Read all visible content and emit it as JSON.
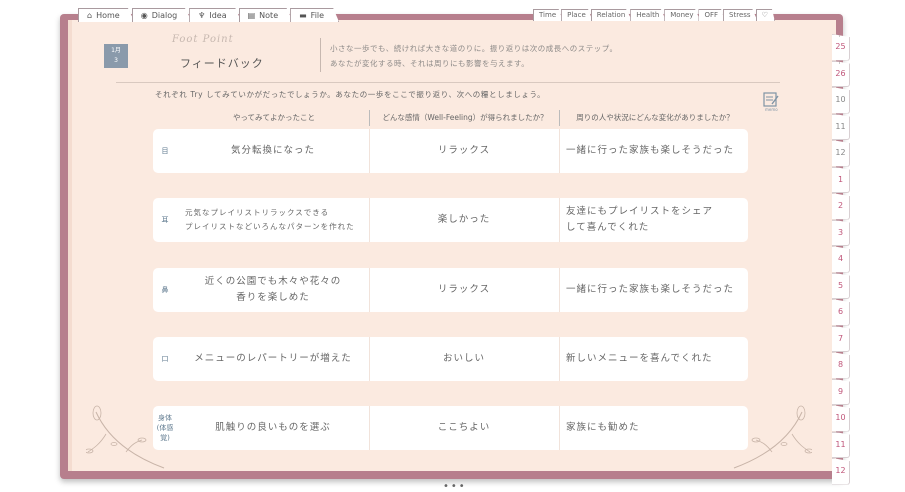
{
  "top_tabs": [
    {
      "icon": "home-icon",
      "glyph": "⌂",
      "label": "Home"
    },
    {
      "icon": "dialog-icon",
      "glyph": "◉",
      "label": "Dialog"
    },
    {
      "icon": "idea-icon",
      "glyph": "♆",
      "label": "Idea"
    },
    {
      "icon": "note-icon",
      "glyph": "▤",
      "label": "Note"
    },
    {
      "icon": "file-icon",
      "glyph": "▬",
      "label": "File"
    }
  ],
  "right_tabs": [
    "Time",
    "Place",
    "Relation",
    "Health",
    "Money",
    "OFF",
    "Stress",
    "♡"
  ],
  "side_tabs": [
    {
      "label": "25",
      "year": "Y",
      "pink": true
    },
    {
      "label": "26",
      "year": "Y",
      "pink": true
    },
    {
      "label": "10",
      "pink": false
    },
    {
      "label": "11",
      "pink": false
    },
    {
      "label": "12",
      "pink": false
    },
    {
      "label": "1",
      "pink": true
    },
    {
      "label": "2",
      "pink": true
    },
    {
      "label": "3",
      "pink": true
    },
    {
      "label": "4",
      "pink": true
    },
    {
      "label": "5",
      "pink": true
    },
    {
      "label": "6",
      "pink": true
    },
    {
      "label": "7",
      "pink": true
    },
    {
      "label": "8",
      "pink": true
    },
    {
      "label": "9",
      "pink": true
    },
    {
      "label": "10",
      "pink": true
    },
    {
      "label": "11",
      "pink": true
    },
    {
      "label": "12",
      "pink": true
    }
  ],
  "header": {
    "date_month": "1月",
    "date_day": "3",
    "script_title": "Foot Point",
    "title": "フィードバック",
    "quote_line1": "小さな一歩でも、続ければ大きな道のりに。振り返りは次の成長へのステップ。",
    "quote_line2": "あなたが変化する時、それは周りにも影響を与えます。"
  },
  "instruction": "それぞれ Try してみていかがだったでしょうか。あなたの一歩をここで振り返り、次への糧としましょう。",
  "memo_label": "memo",
  "columns": [
    "やってみてよかったこと",
    "どんな感情（Well-Feeling）が得られましたか？",
    "周りの人や状況にどんな変化がありましたか？"
  ],
  "rows": [
    {
      "label": "目",
      "did": "気分転換になった",
      "feeling": "リラックス",
      "change": "一緒に行った家族も楽しそうだった",
      "small": false
    },
    {
      "label": "耳",
      "did": "元気なプレイリストリラックスできる\nプレイリストなどいろんなパターンを作れた",
      "feeling": "楽しかった",
      "change": "友達にもプレイリストをシェア\nして喜んでくれた",
      "small": true
    },
    {
      "label": "鼻",
      "did": "近くの公園でも木々や花々の\n香りを楽しめた",
      "feeling": "リラックス",
      "change": "一緒に行った家族も楽しそうだった",
      "small": false
    },
    {
      "label": "口",
      "did": "メニューのレパートリーが増えた",
      "feeling": "おいしい",
      "change": "新しいメニューを喜んでくれた",
      "small": false
    },
    {
      "label": "身体\n(体感覚)",
      "did": "肌触りの良いものを選ぶ",
      "feeling": "ここちよい",
      "change": "家族にも勧めた",
      "small": false
    }
  ],
  "bottom_dots": "•••",
  "colors": {
    "cover": "#b77f8d",
    "paper": "#fbeae0",
    "label_blue": "#5f7a8f"
  }
}
